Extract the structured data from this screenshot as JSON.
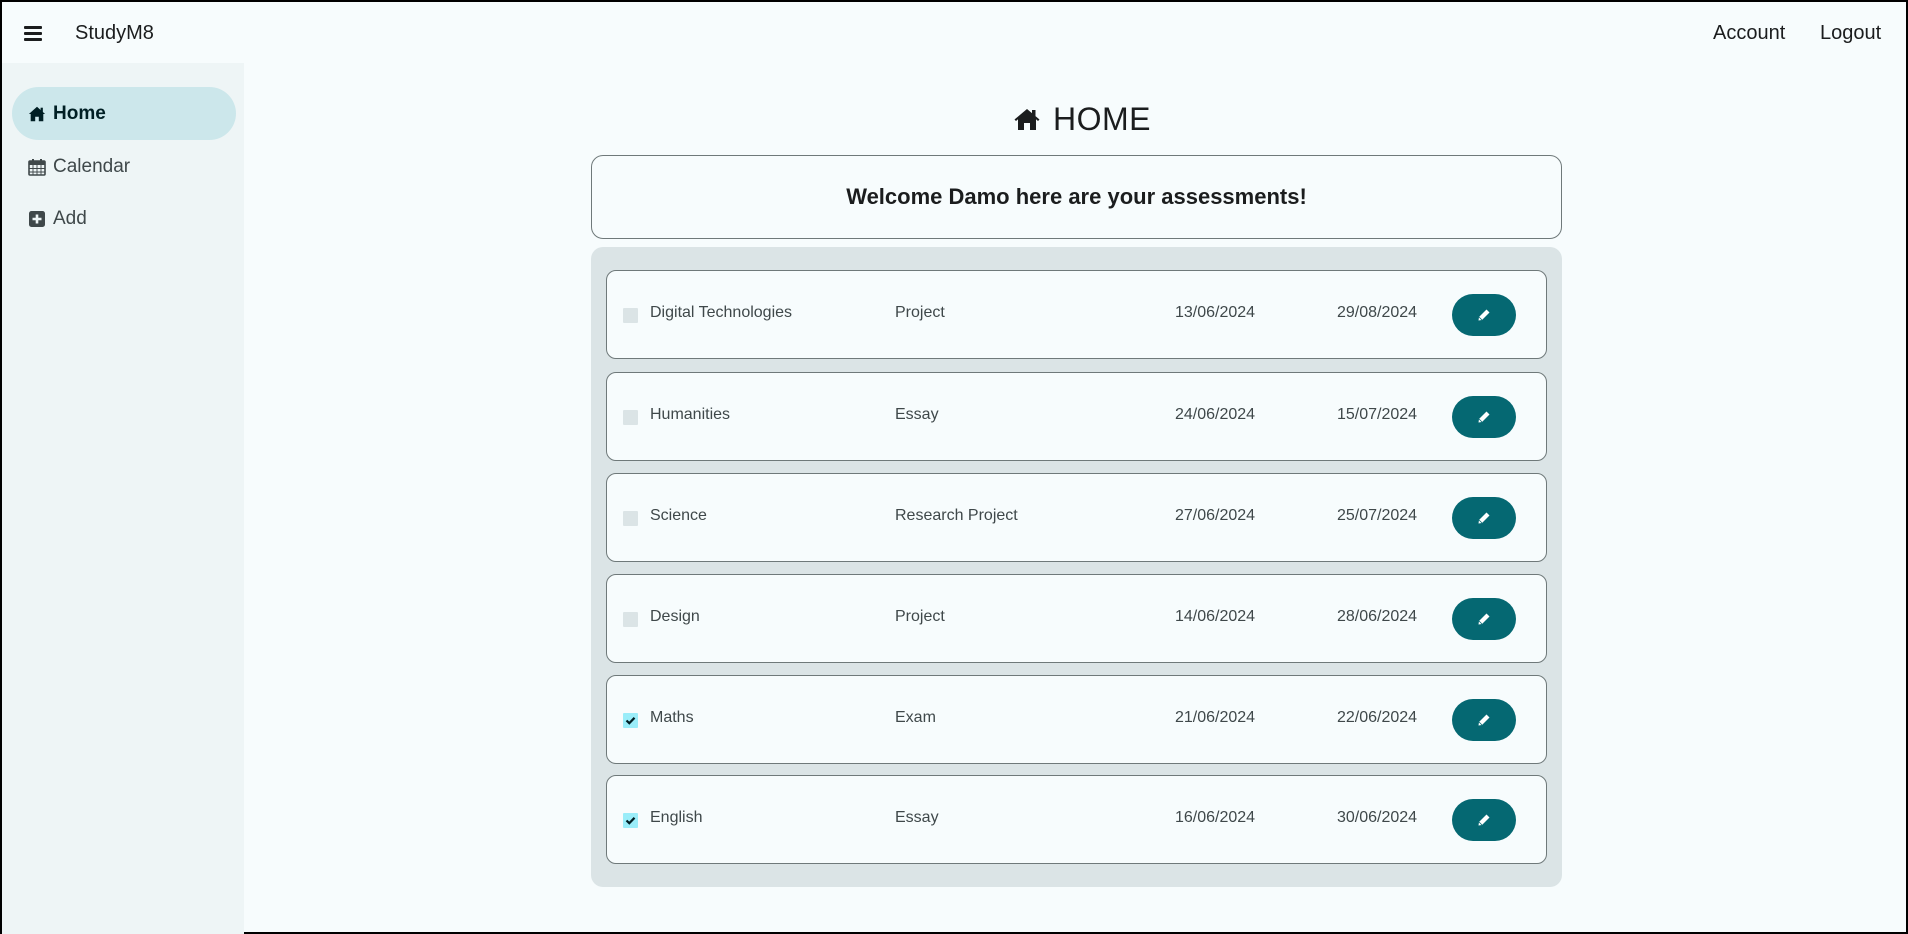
{
  "header": {
    "brand": "StudyM8",
    "menu_icon": "hamburger-menu-icon",
    "nav": [
      {
        "label": "Account"
      },
      {
        "label": "Logout"
      }
    ]
  },
  "sidebar": {
    "items": [
      {
        "label": "Home",
        "icon": "home-icon",
        "active": true
      },
      {
        "label": "Calendar",
        "icon": "calendar-icon",
        "active": false
      },
      {
        "label": "Add",
        "icon": "plus-square-icon",
        "active": false
      }
    ]
  },
  "main": {
    "title": "HOME",
    "title_icon": "home-icon",
    "welcome": "Welcome Damo here are your assessments!",
    "assessments": [
      {
        "subject": "Digital Technologies",
        "type": "Project",
        "start": "13/06/2024",
        "due": "29/08/2024",
        "completed": false
      },
      {
        "subject": "Humanities",
        "type": "Essay",
        "start": "24/06/2024",
        "due": "15/07/2024",
        "completed": false
      },
      {
        "subject": "Science",
        "type": "Research Project",
        "start": "27/06/2024",
        "due": "25/07/2024",
        "completed": false
      },
      {
        "subject": "Design",
        "type": "Project",
        "start": "14/06/2024",
        "due": "28/06/2024",
        "completed": false
      },
      {
        "subject": "Maths",
        "type": "Exam",
        "start": "21/06/2024",
        "due": "22/06/2024",
        "completed": true
      },
      {
        "subject": "English",
        "type": "Essay",
        "start": "16/06/2024",
        "due": "30/06/2024",
        "completed": true
      }
    ],
    "edit_icon": "pencil-icon"
  },
  "colors": {
    "accent": "#056872",
    "active_nav": "#cce7eb",
    "checkbox_checked": "#9aedf9",
    "sidebar_bg": "#eef5f6",
    "list_bg": "#dbe4e6",
    "page_bg": "#f7fcfd"
  }
}
